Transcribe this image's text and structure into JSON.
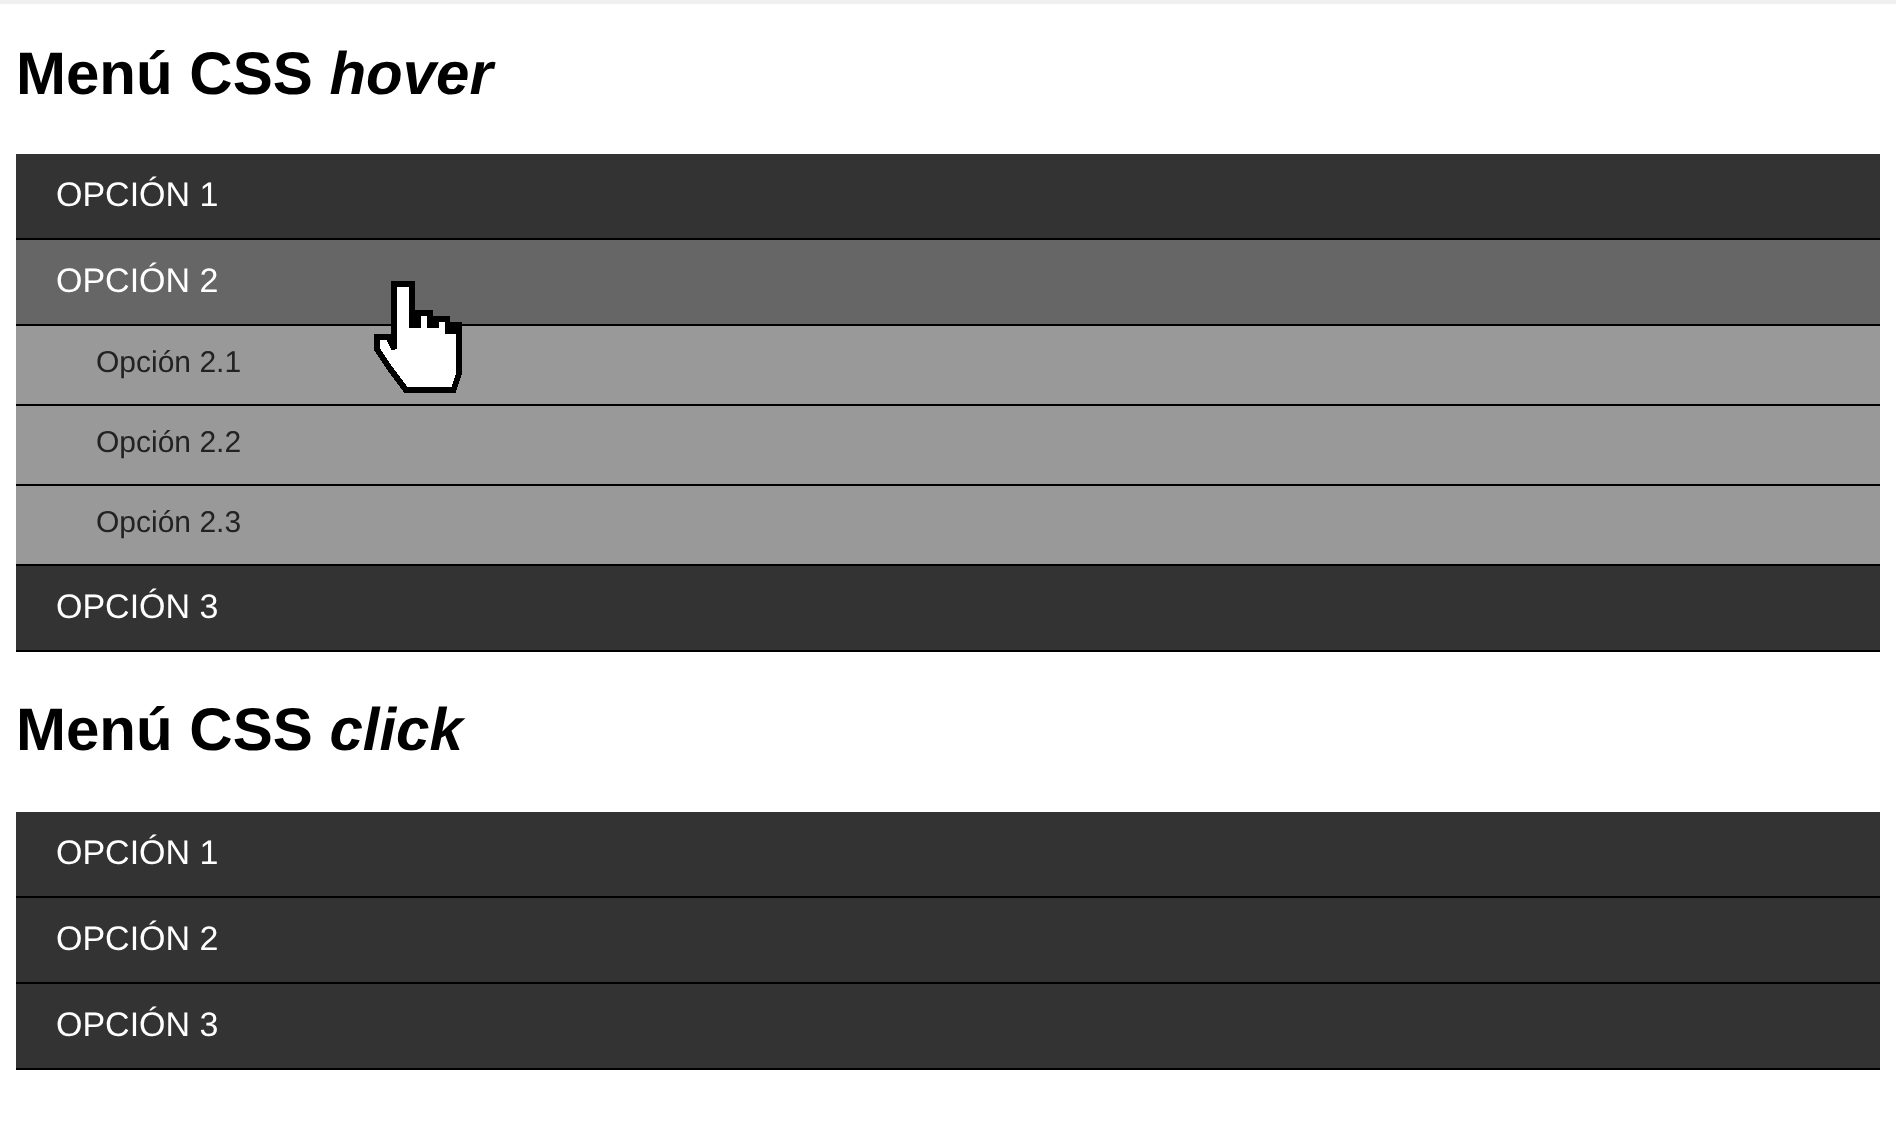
{
  "sections": [
    {
      "title": "Menú CSS *hover*",
      "items": [
        {
          "label": "OPCIÓN 1",
          "hovered": false
        },
        {
          "label": "OPCIÓN 2",
          "hovered": true,
          "children": [
            {
              "label": "Opción 2.1"
            },
            {
              "label": "Opción 2.2"
            },
            {
              "label": "Opción 2.3"
            }
          ]
        },
        {
          "label": "OPCIÓN 3",
          "hovered": false
        }
      ]
    },
    {
      "title": "Menú CSS *click*",
      "items": [
        {
          "label": "OPCIÓN 1",
          "hovered": false
        },
        {
          "label": "OPCIÓN 2",
          "hovered": false
        },
        {
          "label": "OPCIÓN 3",
          "hovered": false
        }
      ]
    }
  ]
}
